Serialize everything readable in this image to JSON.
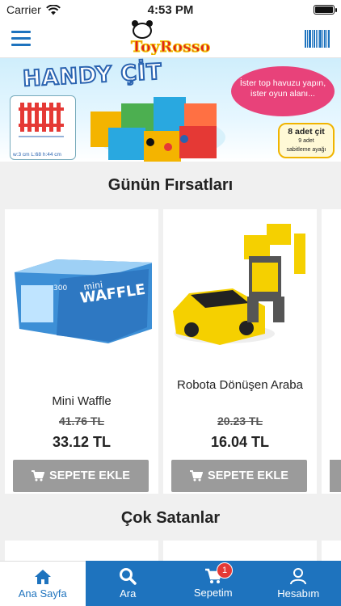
{
  "status_bar": {
    "carrier": "Carrier",
    "time": "4:53 PM"
  },
  "header": {
    "logo_text": "ToyRosso"
  },
  "banner": {
    "title": "HANDY ÇİT",
    "bubble_text": "İster top havuzu yapın, ister oyun alanı...",
    "tag_line1": "8 adet çit",
    "tag_line2": "9 adet",
    "tag_line3": "sabitleme ayağı",
    "dims": "w:3 cm L:68 h:44 cm"
  },
  "sections": {
    "deals_title": "Günün Fırsatları",
    "bestsellers_title": "Çok Satanlar"
  },
  "products": [
    {
      "name": "Mini Waffle",
      "old_price": "41.76 TL",
      "price": "33.12 TL",
      "button": "SEPETE EKLE"
    },
    {
      "name": "Robota  Dönüşen Araba",
      "old_price": "20.23 TL",
      "price": "16.04 TL",
      "button": "SEPETE EKLE"
    }
  ],
  "tabs": [
    {
      "label": "Ana Sayfa",
      "icon": "home-icon"
    },
    {
      "label": "Ara",
      "icon": "search-icon"
    },
    {
      "label": "Sepetim",
      "icon": "cart-icon",
      "badge": "1"
    },
    {
      "label": "Hesabım",
      "icon": "user-icon"
    }
  ],
  "colors": {
    "brand_blue": "#1e73be",
    "button_gray": "#9b9b9b",
    "badge_red": "#e53935"
  }
}
